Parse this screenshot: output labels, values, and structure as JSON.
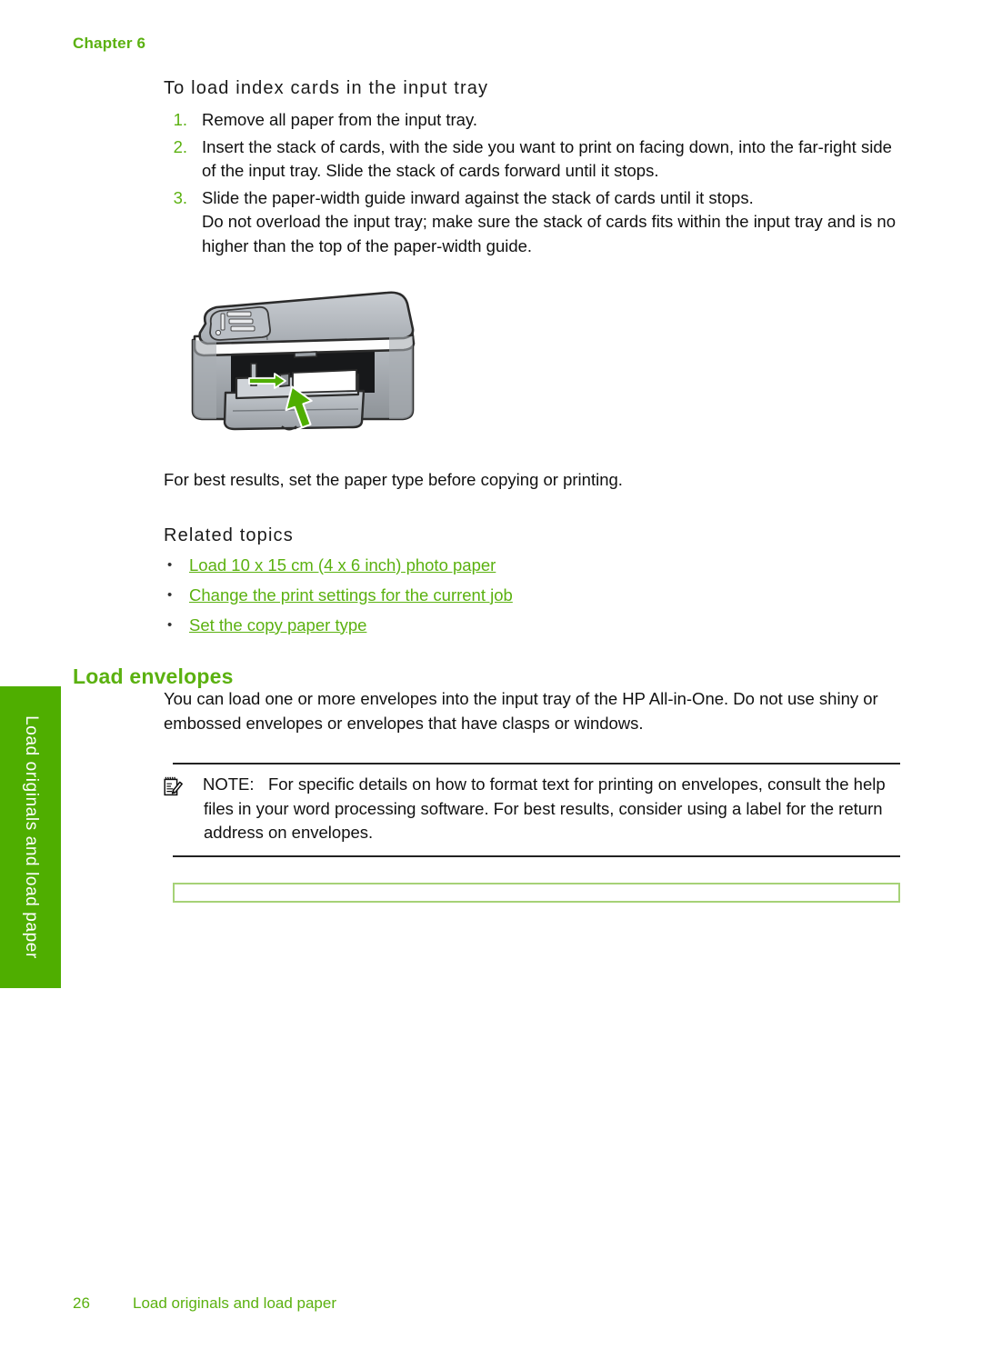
{
  "chapter": {
    "label": "Chapter 6"
  },
  "index_cards": {
    "heading": "To load index cards in the input tray",
    "steps": [
      {
        "num": "1.",
        "text": "Remove all paper from the input tray."
      },
      {
        "num": "2.",
        "text": "Insert the stack of cards, with the side you want to print on facing down, into the far-right side of the input tray. Slide the stack of cards forward until it stops."
      },
      {
        "num": "3.",
        "text": "Slide the paper-width guide inward against the stack of cards until it stops."
      }
    ],
    "step_note": "Do not overload the input tray; make sure the stack of cards fits within the input tray and is no higher than the top of the paper-width guide.",
    "figure_alt": "HP All-in-One printer with input tray open and green arrows showing paper-width guide and card stack direction",
    "best_results": "For best results, set the paper type before copying or printing."
  },
  "related_topics": {
    "heading": "Related topics",
    "bullet": "•",
    "links": [
      "Load 10 x 15 cm (4 x 6 inch) photo paper",
      "Change the print settings for the current job",
      "Set the copy paper type"
    ]
  },
  "load_envelopes": {
    "heading": "Load envelopes",
    "intro": "You can load one or more envelopes into the input tray of the HP All-in-One. Do not use shiny or embossed envelopes or envelopes that have clasps or windows.",
    "note": {
      "label": "NOTE:",
      "spacer": "   ",
      "text": "For specific details on how to format text for printing on envelopes, consult the help files in your word processing software. For best results, consider using a label for the return address on envelopes."
    },
    "placeholder_box": ""
  },
  "side_tab": {
    "label": "Load originals and load paper"
  },
  "footer": {
    "page_number": "26",
    "section_title": "Load originals and load paper"
  },
  "colors": {
    "brand_green": "#5bb110",
    "tab_green": "#4fae00",
    "box_border_green": "#a6d277",
    "text_black": "#111111"
  }
}
